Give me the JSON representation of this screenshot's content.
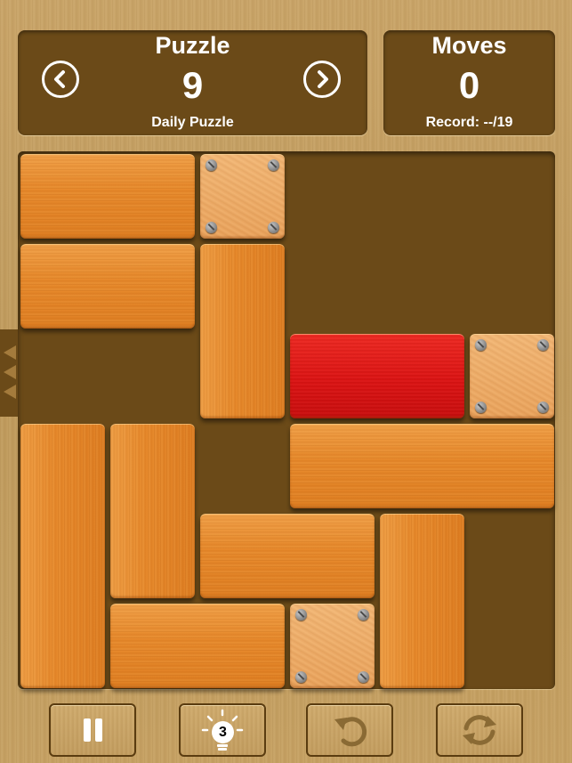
{
  "puzzle_panel": {
    "title": "Puzzle",
    "number": "9",
    "subtitle": "Daily Puzzle"
  },
  "moves_panel": {
    "title": "Moves",
    "number": "0",
    "record": "Record: --/19"
  },
  "icons": {
    "prev": "chevron-left-icon",
    "next": "chevron-right-icon",
    "pause": "pause-icon",
    "hint": "lightbulb-icon",
    "undo": "undo-icon",
    "reset": "reset-icon"
  },
  "controls": {
    "hint_count": "3"
  },
  "board": {
    "grid_size": "6x6",
    "exit_side": "left",
    "exit_row": 3,
    "blocks": [
      {
        "type": "wood",
        "orientation": "horizontal",
        "row": 1,
        "col": 1,
        "length": 2
      },
      {
        "type": "fixed",
        "row": 1,
        "col": 3,
        "length": 1
      },
      {
        "type": "wood",
        "orientation": "horizontal",
        "row": 2,
        "col": 1,
        "length": 2
      },
      {
        "type": "wood",
        "orientation": "vertical",
        "row": 2,
        "col": 3,
        "length": 2
      },
      {
        "type": "target",
        "orientation": "horizontal",
        "row": 3,
        "col": 4,
        "length": 2
      },
      {
        "type": "fixed",
        "row": 3,
        "col": 6,
        "length": 1
      },
      {
        "type": "wood",
        "orientation": "vertical",
        "row": 4,
        "col": 1,
        "length": 3
      },
      {
        "type": "wood",
        "orientation": "vertical",
        "row": 4,
        "col": 2,
        "length": 2
      },
      {
        "type": "wood",
        "orientation": "horizontal",
        "row": 4,
        "col": 4,
        "length": 3
      },
      {
        "type": "wood",
        "orientation": "horizontal",
        "row": 5,
        "col": 3,
        "length": 2
      },
      {
        "type": "wood",
        "orientation": "vertical",
        "row": 5,
        "col": 5,
        "length": 2
      },
      {
        "type": "wood",
        "orientation": "horizontal",
        "row": 6,
        "col": 2,
        "length": 2
      },
      {
        "type": "fixed",
        "row": 6,
        "col": 4,
        "length": 1
      }
    ]
  },
  "colors": {
    "panel": "#6b4a18",
    "wood": "#e88a2c",
    "target": "#dc1212",
    "fixed": "#eaa35d",
    "background": "#c49f60"
  }
}
